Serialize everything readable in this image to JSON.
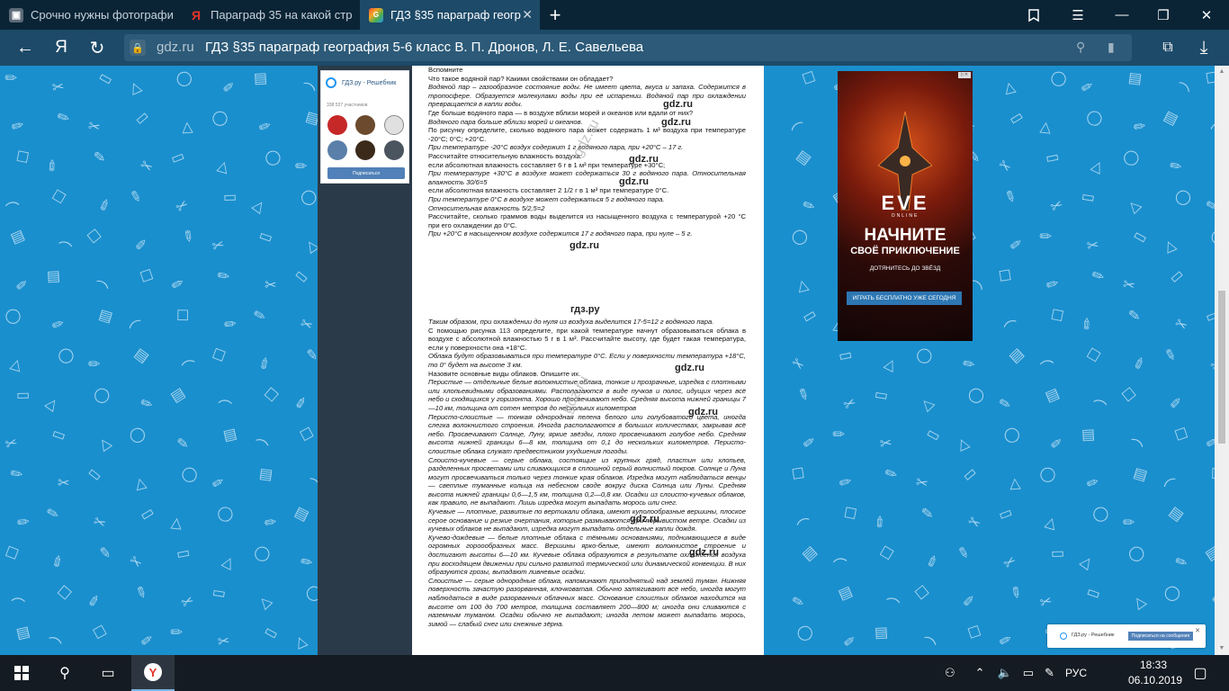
{
  "tabs": [
    {
      "title": "Срочно нужны фотографи",
      "icon": "image-tab-icon"
    },
    {
      "title": "Параграф 35 на какой стр",
      "icon": "yandex-tab-icon"
    },
    {
      "title": "ГДЗ §35 параграф геогр",
      "icon": "gdz-tab-icon",
      "active": true
    }
  ],
  "address": {
    "domain": "gdz.ru",
    "page_title": "ГДЗ §35 параграф география 5-6 класс В. П. Дронов, Л. Е. Савельева"
  },
  "vk_widget": {
    "title": "ГДЗ.ру - Решебник",
    "members": "338 537 участников",
    "subscribe": "Подписаться"
  },
  "article": {
    "lines_top": [
      {
        "t": "Вспомните",
        "i": false
      },
      {
        "t": "Что такое водяной пар? Какими свойствами он обладает?",
        "i": false
      },
      {
        "t": "Водяной пар – газообразное состояние воды. Не имеет цвета, вкуса и запаха. Содержится в тропосфере. Образуется молекулами воды при её испарении. Водяной пар при охлаждении превращается в капли воды.",
        "i": true
      },
      {
        "t": "Где больше водяного пара — в воздухе вблизи морей и океанов или вдали от них?",
        "i": false
      },
      {
        "t": "Водяного пара больше вблизи морей и океанов.",
        "i": true
      },
      {
        "t": "По рисунку определите, сколько водяного пара может содержать 1 м³ воздуха при температуре -20°С; 0°С; +20°С.",
        "i": false
      },
      {
        "t": "При температуре -20°С воздух содержит 1 г водяного пара, при +20°С – 17 г.",
        "i": true
      },
      {
        "t": "Рассчитайте относительную влажность воздуха:",
        "i": false
      },
      {
        "t": "если абсолютная влажность составляет 6 г в 1 м³ при температуре +30°С;",
        "i": false
      },
      {
        "t": "При температуре +30°С в воздухе может содержаться 30 г водяного пара. Относительная влажность 30/6=5",
        "i": true
      },
      {
        "t": "если абсолютная влажность составляет 2 1/2 г в 1 м³ при температуре 0°С.",
        "i": false
      },
      {
        "t": "При температуре 0°С в воздухе может содержаться 5 г водяного пара.",
        "i": true
      },
      {
        "t": "Относительная влажность 5/2,5=2",
        "i": true
      },
      {
        "t": "Рассчитайте, сколько граммов воды выделится из насыщенного воздуха с температурой +20 °С при его охлаждении до 0°С.",
        "i": false
      },
      {
        "t": "При +20°С в насыщенном воздухе содержится 17 г водяного пара, при нуле – 5 г.",
        "i": true
      }
    ],
    "lines_bottom": [
      {
        "t": "Таким образом, при охлаждении до нуля из воздуха выделится 17-5=12 г водяного пара.",
        "i": true
      },
      {
        "t": "С помощью рисунка 113 определите, при какой температуре начнут образовываться облака в воздухе с абсолютной влажностью 5 г в 1 м³. Рассчитайте высоту, где будет такая температура, если у поверхности она +18°С.",
        "i": false
      },
      {
        "t": "Облака будут образовываться при температуре 0°С. Если у поверхности температура +18°С, то 0° будет на высоте 3 км.",
        "i": true
      },
      {
        "t": "Назовите основные виды облаков. Опишите их.",
        "i": false
      },
      {
        "t": "Перистые — отдельные белые волокнистые облака, тонкие и прозрачные, изредка с плотными или хлопьевидными образованиями. Располагаются в виде пучков и полос, идущих через всё небо и сходящихся у горизонта. Хорошо просвечивают небо. Средняя высота нижней границы 7—10 км, толщина от сотен метров до нескольких километров",
        "i": true
      },
      {
        "t": "Перисто-слоистые — тонкая однородная пелена белого или голубоватого цвета, иногда слегка волокнистого строения. Иногда располагаются в больших количествах, закрывая всё небо. Просвечивают Солнце, Луну, яркие звёзды, плохо просвечивают голубое небо. Средняя высота нижней границы 6—8 км, толщина от 0,1 до нескольких километров. Перисто-слоистые облака служат предвестником ухудшения погоды.",
        "i": true
      },
      {
        "t": "Слоисто-кучевые — серые облака, состоящие из крупных гряд, пластин или хлопьев, разделенных просветами или сливающихся в сплошной серый волнистый покров. Солнце и Луна могут просвечиваться только через тонкие края облаков. Изредка могут наблюдаться венцы — светлые туманные кольца на небесном своде вокруг диска Солнца или Луны. Средняя высота нижней границы 0,6—1,5 км, толщина 0,2—0,8 км. Осадки из слоисто-кучевых облаков, как правило, не выпадают. Лишь изредка могут выпадать морось или снег.",
        "i": true
      },
      {
        "t": "Кучевые — плотные, развитые по вертикали облака, имеют куполообразные вершины, плоское серое основание и резкие очертания, которые размываются при порывистом ветре. Осадки из кучевых облаков не выпадают, изредка могут выпадать отдельные капли дождя.",
        "i": true
      },
      {
        "t": "Кучево-дождевые — белые плотные облака с тёмными основаниями, поднимающиеся в виде огромных гороообразных масс. Вершины ярко-белые, имеют волокнистое строение и достигают высоты 6—10 км. Кучевые облака образуются в результате охлаждения воздуха при восходящем движении при сильно развитой термической или динамической конвекции. В них образуются грозы, выпадают ливневые осадки.",
        "i": true
      },
      {
        "t": "Слоистые — серые однородные облака, напоминают приподнятый над землёй туман. Нижняя поверхность зачастую разорванная, клочковатая. Обычно затягивают всё небо, иногда могут наблюдаться в виде разорванных облачных масс. Основание слоистых облаков находится на высоте от 100 до 700 метров, толщина составляет 200—800 м; иногда они сливаются с наземным туманом. Осадки обычно не выпадают; иногда летом может выпадать морось, зимой — слабый снег или снежные зёрна.",
        "i": true
      }
    ],
    "watermark": "gdz.ru",
    "watermark_center": "гдз.ру",
    "watermark_diag": "gdz.ru"
  },
  "ad": {
    "brand": "EVE",
    "brand_sub": "ONLINE",
    "headline": "НАЧНИТЕ",
    "subheadline": "СВОЁ ПРИКЛЮЧЕНИЕ",
    "tagline": "ДОТЯНИТЕСЬ ДО ЗВЁЗД",
    "cta": "ИГРАТЬ БЕСПЛАТНО УЖЕ СЕГОДНЯ"
  },
  "notification": {
    "text": "ГДЗ.ру - Решебник",
    "button": "Подписаться на сообщения"
  },
  "taskbar": {
    "lang": "РУС",
    "time": "18:33",
    "date": "06.10.2019"
  },
  "colors": {
    "tabbar": "#0a2436",
    "address_bar": "#1d4a68",
    "page_bg": "#1a8fce",
    "vk_blue": "#5181b8"
  }
}
